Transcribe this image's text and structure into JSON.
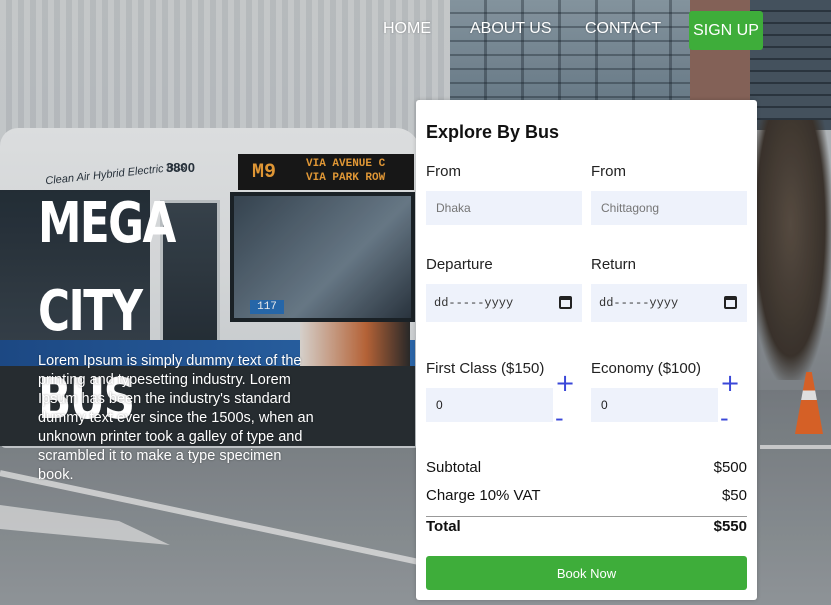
{
  "nav": {
    "home": "HOME",
    "about": "ABOUT US",
    "contact": "CONTACT",
    "signup": "SIGN UP"
  },
  "hero": {
    "title_line1": "MEGA CITY",
    "title_line2": "BUS",
    "description": "Lorem Ipsum is simply dummy text of the printing and typesetting industry. Lorem Ipsum has been the industry's standard dummy text ever since the 1500s, when an unknown printer took a galley of type and scrambled it to make a type specimen book."
  },
  "background": {
    "bus_sign_line1": "M9",
    "bus_sign_line2": "VIA AVENUE C",
    "bus_sign_line3": "VIA PARK ROW",
    "bus_number": "3800",
    "bus_side_text": "Clean Air Hybrid Electric Bus",
    "bus_plate": "117"
  },
  "booking": {
    "title": "Explore By Bus",
    "from_label_1": "From",
    "from_label_2": "From",
    "from_value": "Dhaka",
    "to_value": "Chittagong",
    "departure_label": "Departure",
    "return_label": "Return",
    "date_placeholder": "dd-----yyyy",
    "first_class_label": "First Class ($150)",
    "economy_label": "Economy ($100)",
    "first_class_qty": "0",
    "economy_qty": "0",
    "plus": "+",
    "minus": "-",
    "subtotal_label": "Subtotal",
    "subtotal_value": "$500",
    "vat_label": "Charge 10% VAT",
    "vat_value": "$50",
    "total_label": "Total",
    "total_value": "$550",
    "book_button": "Book Now"
  },
  "colors": {
    "accent_green": "#3ead3a",
    "stepper_blue": "#3a47d8",
    "field_bg": "#eef2fb"
  }
}
